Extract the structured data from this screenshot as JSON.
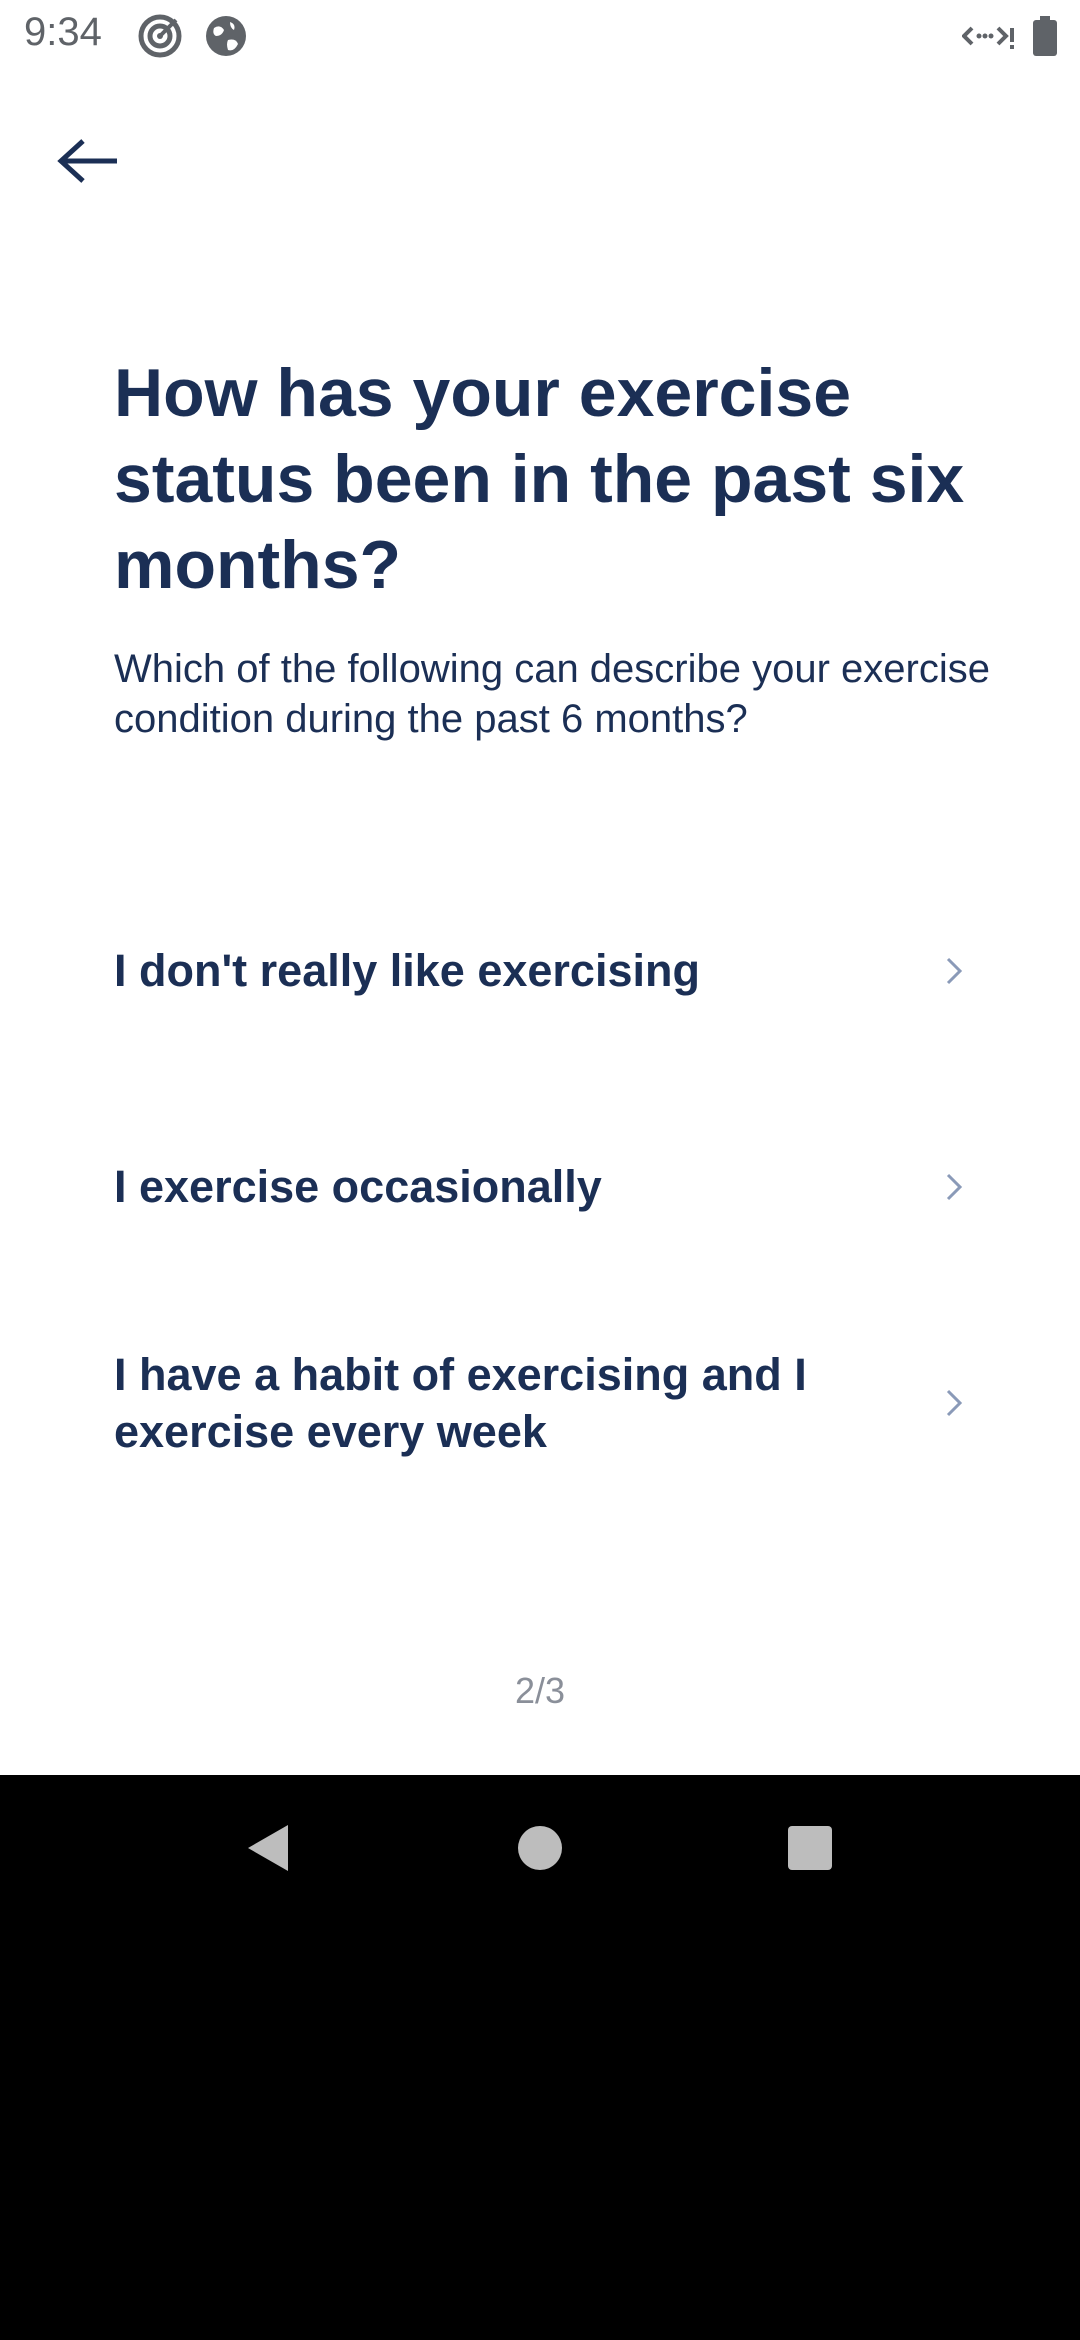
{
  "status_bar": {
    "time": "9:34",
    "icons": [
      "target-icon",
      "globe-icon",
      "data-transfer-icon",
      "battery-icon"
    ]
  },
  "header": {
    "back_icon": "arrow-left-icon"
  },
  "question": {
    "title": "How has your exercise status been in the past six months?",
    "subtitle": "Which of the following can describe your exercise condition during the past 6 months?"
  },
  "options": [
    {
      "label": "I don't really like exercising",
      "icon": "chevron-right-icon"
    },
    {
      "label": "I exercise occasionally",
      "icon": "chevron-right-icon"
    },
    {
      "label": "I have a habit of exercising and I exercise every week",
      "icon": "chevron-right-icon"
    }
  ],
  "progress": {
    "label": "2/3",
    "current": 2,
    "total": 3
  },
  "navigation": {
    "icons": [
      "nav-back-icon",
      "nav-home-icon",
      "nav-recents-icon"
    ]
  },
  "colors": {
    "primary_text": "#1b2f55",
    "chevron": "#8a9ab8",
    "muted_text": "#8a8f99",
    "status_icons": "#5f6368",
    "nav_background": "#000000",
    "nav_icons": "#bdbdbd"
  }
}
